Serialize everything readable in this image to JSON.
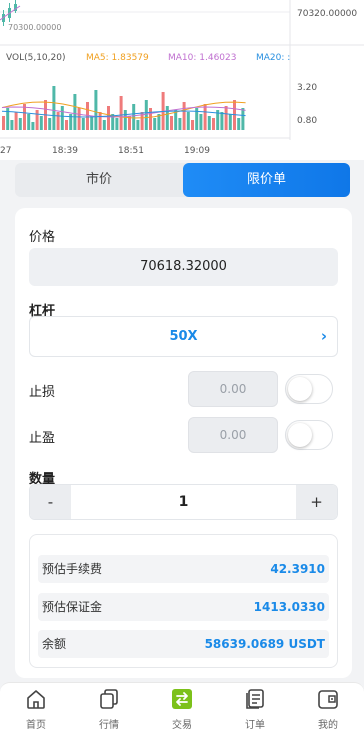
{
  "chart": {
    "price_tag_left": "70300.00000",
    "price_tag_right": "70320.00000",
    "vol_label": "VOL(5,10,20)",
    "ma5_label": "MA5: 1.83579",
    "ma10_label": "MA10: 1.46023",
    "ma20_label": "MA20: :",
    "vol_axis_top": "3.20",
    "vol_axis_bottom": "0.80",
    "time_labels": [
      "27",
      "18:39",
      "18:51",
      "19:09"
    ],
    "colors": {
      "ma5": "#f0a020",
      "ma10": "#c070d0",
      "ma20": "#2a90e0",
      "up": "#4fb8a8",
      "down": "#ef7b7b"
    }
  },
  "order_tabs": {
    "market": "市价",
    "limit": "限价单"
  },
  "form": {
    "price_label": "价格",
    "price_value": "70618.32000",
    "leverage_label": "杠杆",
    "leverage_value": "50X",
    "leverage_arrow": "›",
    "stop_loss_label": "止损",
    "stop_loss_value": "0.00",
    "take_profit_label": "止盈",
    "take_profit_value": "0.00",
    "quantity_label": "数量",
    "quantity_minus": "-",
    "quantity_value": "1",
    "quantity_plus": "+"
  },
  "summary": [
    {
      "label": "预估手续费",
      "value": "42.3910"
    },
    {
      "label": "预估保证金",
      "value": "1413.0330"
    },
    {
      "label": "余额",
      "value": "58639.0689 USDT"
    }
  ],
  "nav": [
    {
      "label": "首页",
      "icon": "home-icon"
    },
    {
      "label": "行情",
      "icon": "market-icon"
    },
    {
      "label": "交易",
      "icon": "trade-icon",
      "active": true
    },
    {
      "label": "订单",
      "icon": "orders-icon"
    },
    {
      "label": "我的",
      "icon": "wallet-icon"
    }
  ]
}
